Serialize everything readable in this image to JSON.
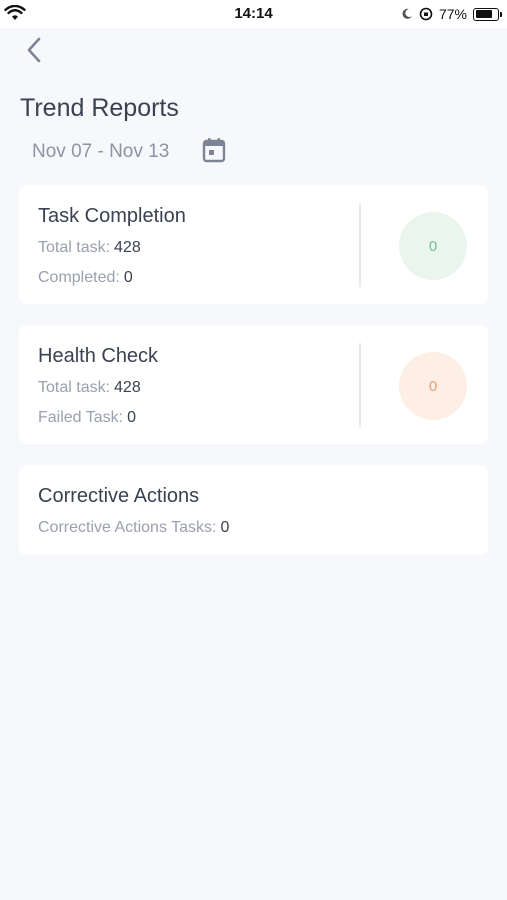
{
  "status_bar": {
    "time": "14:14",
    "battery": "77%"
  },
  "header": {
    "title": "Trend Reports",
    "date_range": "Nov 07 - Nov 13"
  },
  "cards": {
    "task_completion": {
      "title": "Task Completion",
      "metric1_label": "Total task:",
      "metric1_value": "428",
      "metric2_label": "Completed:",
      "metric2_value": "0",
      "circle_value": "0",
      "circle_color": "#eaf5ee",
      "circle_text_color": "#6cc08b"
    },
    "health_check": {
      "title": "Health Check",
      "metric1_label": "Total task:",
      "metric1_value": "428",
      "metric2_label": "Failed Task:",
      "metric2_value": "0",
      "circle_value": "0",
      "circle_color": "#fdefe6",
      "circle_text_color": "#e5a070"
    },
    "corrective_actions": {
      "title": "Corrective Actions",
      "metric1_label": "Corrective Actions Tasks:",
      "metric1_value": "0"
    }
  },
  "icons": {
    "back": "chevron-left-icon",
    "calendar": "calendar-icon"
  }
}
